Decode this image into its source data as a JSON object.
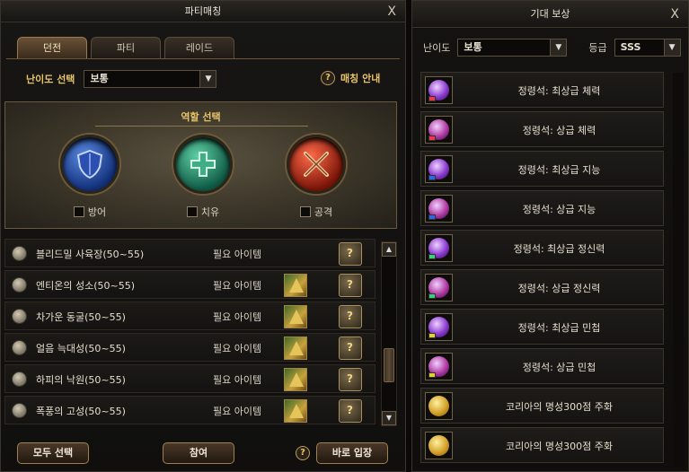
{
  "left": {
    "title": "파티매칭",
    "close": "X",
    "tabs": [
      "던전",
      "파티",
      "레이드"
    ],
    "difficulty_label": "난이도 선택",
    "difficulty_value": "보통",
    "guide_label": "매칭 안내",
    "role_title": "역할 선택",
    "roles": [
      "방어",
      "치유",
      "공격"
    ],
    "dungeons": [
      {
        "name": "블리드밀 사육장(50~55)",
        "req": "필요 아이템",
        "has_item": false
      },
      {
        "name": "엔티온의 성소(50~55)",
        "req": "필요 아이템",
        "has_item": true
      },
      {
        "name": "차가운 동굴(50~55)",
        "req": "필요 아이템",
        "has_item": true
      },
      {
        "name": "얼음 늑대성(50~55)",
        "req": "필요 아이템",
        "has_item": true
      },
      {
        "name": "하피의 낙원(50~55)",
        "req": "필요 아이템",
        "has_item": true
      },
      {
        "name": "폭풍의 고성(50~55)",
        "req": "필요 아이템",
        "has_item": true
      }
    ],
    "buttons": {
      "select_all": "모두 선택",
      "join": "참여",
      "enter_now": "바로 입장",
      "help": "?"
    }
  },
  "right": {
    "title": "기대 보상",
    "close": "X",
    "difficulty_label": "난이도",
    "difficulty_value": "보통",
    "grade_label": "등급",
    "grade_value": "SSS",
    "rewards": [
      {
        "name": "정령석: 최상급 체력",
        "color": "#8a3ad0",
        "mini": "#e83a4a"
      },
      {
        "name": "정령석: 상급 체력",
        "color": "#b03aa0",
        "mini": "#e83a4a"
      },
      {
        "name": "정령석: 최상급 지능",
        "color": "#8a3ad0",
        "mini": "#2a6ae0"
      },
      {
        "name": "정령석: 상급 지능",
        "color": "#b03aa0",
        "mini": "#2a6ae0"
      },
      {
        "name": "정령석: 최상급 정신력",
        "color": "#8a3ad0",
        "mini": "#3ad07a"
      },
      {
        "name": "정령석: 상급 정신력",
        "color": "#b03aa0",
        "mini": "#3ad07a"
      },
      {
        "name": "정령석: 최상급 민첩",
        "color": "#8a3ad0",
        "mini": "#e0d03a"
      },
      {
        "name": "정령석: 상급 민첩",
        "color": "#b03aa0",
        "mini": "#e0d03a"
      },
      {
        "name": "코리아의 명성300점 주화",
        "coin": true
      },
      {
        "name": "코리아의 명성300점 주화",
        "coin": true
      }
    ]
  }
}
